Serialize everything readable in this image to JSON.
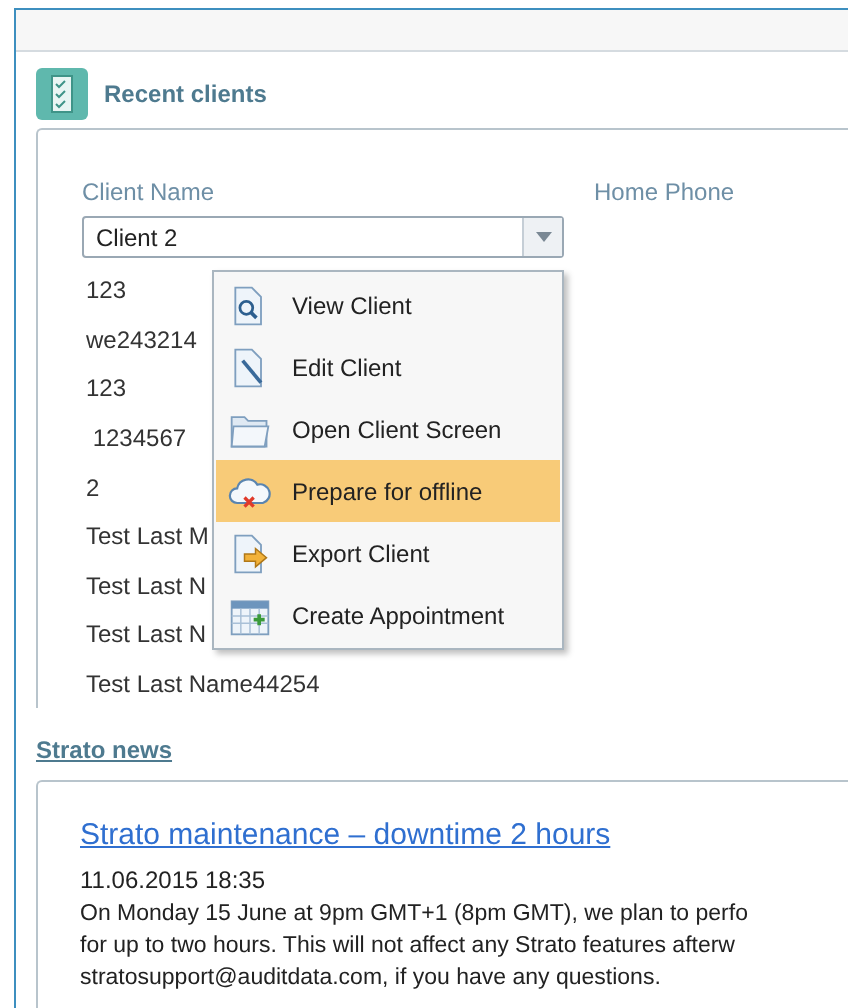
{
  "recent_clients": {
    "title": "Recent clients",
    "columns": [
      "Client Name",
      "Home Phone"
    ],
    "client_select": {
      "value": "Client 2"
    },
    "rows": [
      "123",
      "we243214",
      "123",
      " 1234567",
      "2",
      "Test Last M",
      "Test Last N",
      "Test Last N",
      "Test Last Name44254"
    ]
  },
  "context_menu": {
    "items": [
      {
        "kind": "view",
        "label": "View Client",
        "selected": false
      },
      {
        "kind": "edit",
        "label": "Edit Client",
        "selected": false
      },
      {
        "kind": "open",
        "label": "Open Client Screen",
        "selected": false
      },
      {
        "kind": "offline",
        "label": "Prepare for offline",
        "selected": true
      },
      {
        "kind": "export",
        "label": "Export Client",
        "selected": false
      },
      {
        "kind": "appointment",
        "label": "Create Appointment",
        "selected": false
      }
    ]
  },
  "news": {
    "title": "Strato news",
    "headline": "Strato maintenance – downtime 2 hours",
    "date": "11.06.2015 18:35",
    "body_lines": [
      "On Monday 15 June at 9pm GMT+1 (8pm GMT), we plan to perfo",
      "for up to two hours. This will not affect any Strato features afterw",
      "stratosupport@auditdata.com, if you have any questions."
    ]
  }
}
